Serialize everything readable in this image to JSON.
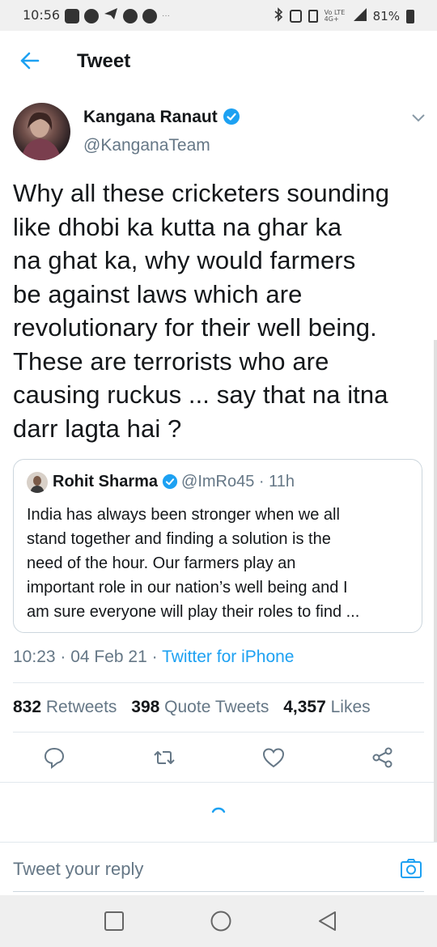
{
  "status_bar": {
    "time": "10:56",
    "ellipsis": "···",
    "network": "Vo LTE 4G+",
    "battery": "81%"
  },
  "header": {
    "title": "Tweet"
  },
  "tweet": {
    "author_name": "Kangana Ranaut",
    "handle": "@KanganaTeam",
    "text_lines": [
      "Why all these cricketers sounding",
      "like dhobi ka kutta na ghar ka",
      "na ghat ka, why would farmers",
      "be against laws which are",
      "revolutionary for their well being.",
      "These are terrorists who are",
      "causing ruckus ... say that na itna",
      "darr lagta hai ?"
    ],
    "timestamp": "10:23 · 04 Feb 21 · ",
    "source": "Twitter for iPhone",
    "stats": {
      "retweets_count": "832",
      "retweets_label": "Retweets",
      "quotes_count": "398",
      "quotes_label": "Quote Tweets",
      "likes_count": "4,357",
      "likes_label": "Likes"
    }
  },
  "quoted_tweet": {
    "author_name": "Rohit Sharma",
    "meta": "@ImRo45 · 11h",
    "text_lines": [
      "India has always been stronger when we all",
      "stand together and finding a solution is the",
      "need of the hour. Our farmers play an",
      "important role in our nation’s well being and I",
      "am sure everyone will play their roles to find ..."
    ]
  },
  "reply": {
    "placeholder": "Tweet your reply"
  },
  "icons": {
    "back": "back-arrow-icon",
    "verified": "verified-badge-icon",
    "chevron": "chevron-down-icon",
    "reply": "reply-icon",
    "retweet": "retweet-icon",
    "like": "heart-icon",
    "share": "share-icon",
    "camera": "camera-icon"
  },
  "colors": {
    "accent": "#1da1f2",
    "secondary_text": "#657786",
    "text": "#14171a",
    "border": "#e1e8ed"
  }
}
